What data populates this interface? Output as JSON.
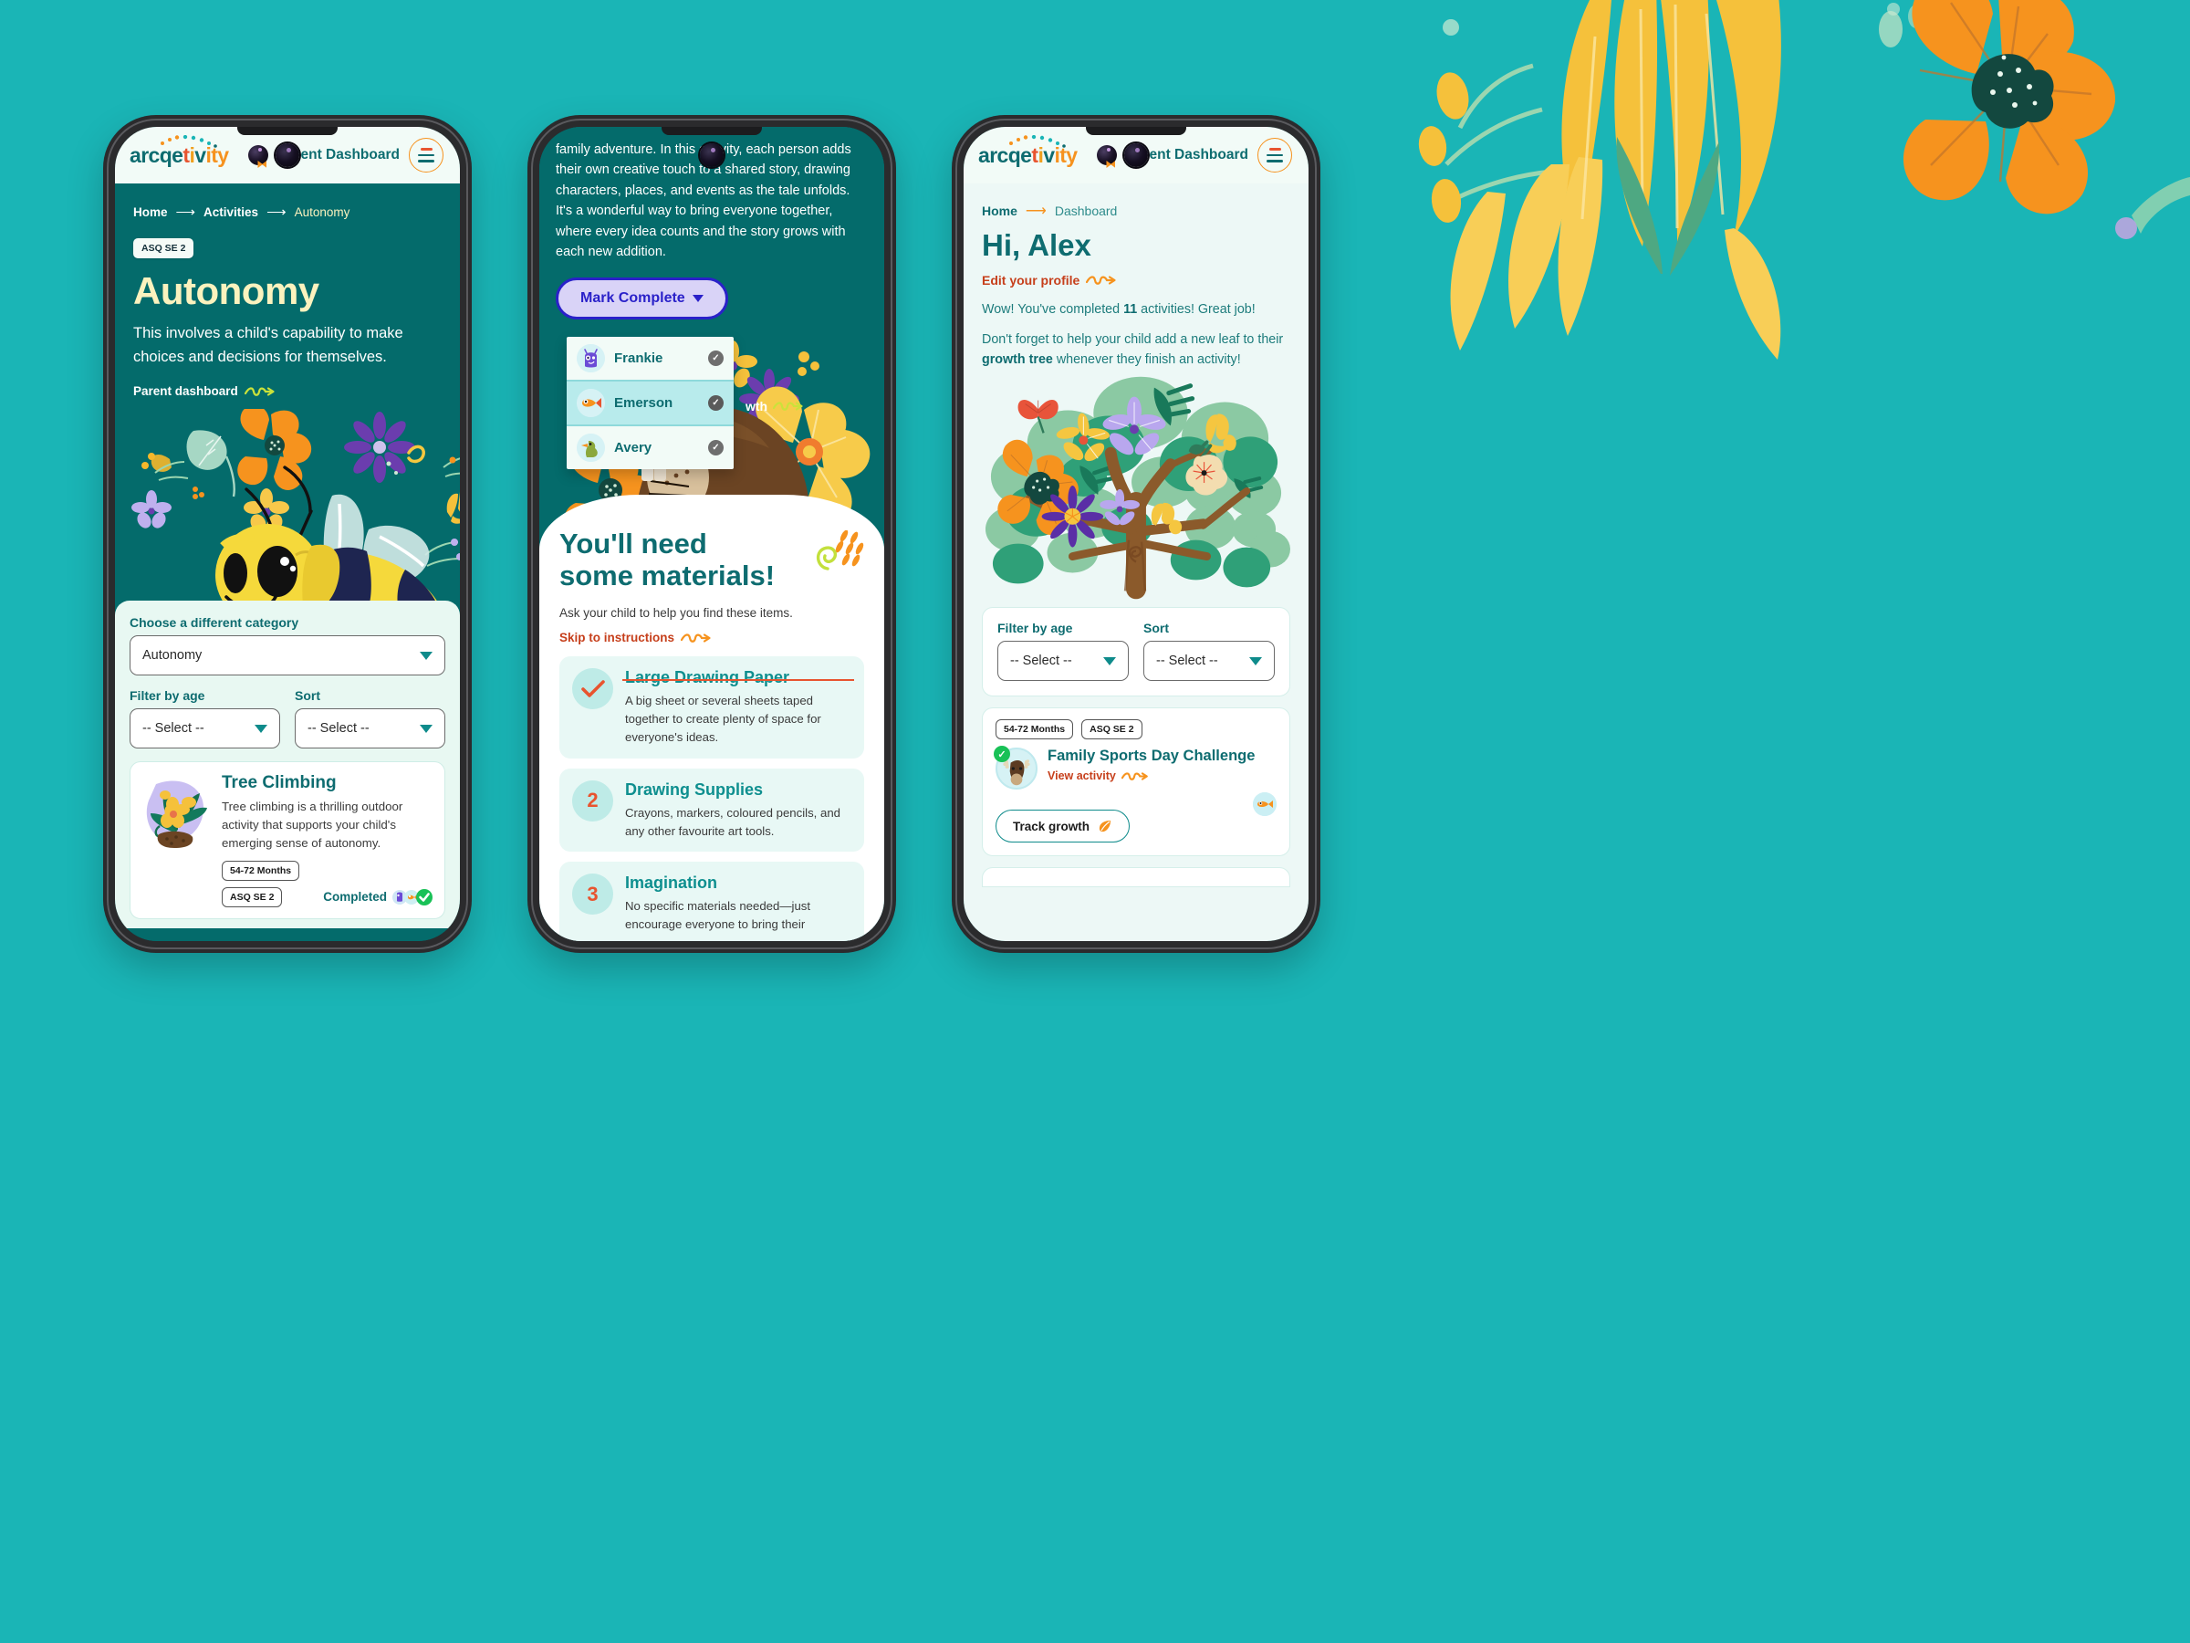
{
  "brand": {
    "logo_parts": [
      "arcqe",
      "t",
      "i",
      "v",
      "ity"
    ],
    "logo_full": "arcqetivity",
    "accent_teal": "#0E6C70",
    "accent_orange": "#F6921E",
    "accent_red": "#E8542F",
    "bg_teal": "#1AB5B6",
    "deep_teal": "#046B6B"
  },
  "header": {
    "dashboard_label": "Parent Dashboard",
    "avatar_name": "user-avatar",
    "menu_icon": "hamburger-menu-icon"
  },
  "phone1": {
    "breadcrumb": {
      "home": "Home",
      "activities": "Activities",
      "current": "Autonomy"
    },
    "badge": "ASQ SE 2",
    "title": "Autonomy",
    "description": "This involves a child's capability to make choices and decisions for themselves.",
    "parent_dashboard_link": "Parent dashboard",
    "hero_illustration": "bee-illustration",
    "panel": {
      "category_label": "Choose a different category",
      "category_value": "Autonomy",
      "age_label": "Filter by age",
      "age_value": "-- Select --",
      "sort_label": "Sort",
      "sort_value": "-- Select --"
    },
    "activity": {
      "thumb": "plant-illustration",
      "title": "Tree Climbing",
      "description": "Tree climbing is a thrilling outdoor activity that supports your child's emerging sense of autonomy.",
      "age_tag": "54-72 Months",
      "framework_tag": "ASQ SE 2",
      "status": "Completed"
    }
  },
  "phone2": {
    "paragraph": "family adventure. In this activity, each person adds their own creative touch to a shared story, drawing characters, places, and events as the tale unfolds. It's a wonderful way to bring everyone together, where every idea counts and the story grows with each new addition.",
    "mark_complete_button": "Mark Complete",
    "kids": [
      {
        "name": "Frankie",
        "avatar": "purple-monster-avatar",
        "selected": false
      },
      {
        "name": "Emerson",
        "avatar": "orange-fish-avatar",
        "selected": true
      },
      {
        "name": "Avery",
        "avatar": "green-duck-avatar",
        "selected": false
      }
    ],
    "partial_link": "wth",
    "hero_illustration": "beaver-illustration",
    "materials": {
      "heading": "You'll need some materials!",
      "subtitle": "Ask your child to help you find these items.",
      "skip_link": "Skip to instructions",
      "items": [
        {
          "marker": "check",
          "title": "Large Drawing Paper",
          "struck": true,
          "description": "A big sheet or several sheets taped together to create plenty of space for everyone's ideas."
        },
        {
          "marker": "2",
          "title": "Drawing Supplies",
          "struck": false,
          "description": "Crayons, markers, coloured pencils, and any other favourite art tools."
        },
        {
          "marker": "3",
          "title": "Imagination",
          "struck": false,
          "description": "No specific materials needed—just encourage everyone to bring their"
        }
      ]
    }
  },
  "phone3": {
    "breadcrumb": {
      "home": "Home",
      "current": "Dashboard"
    },
    "greeting": "Hi, Alex",
    "edit_profile_link": "Edit your profile",
    "completed_line_pre": "Wow! You've completed ",
    "completed_count": "11",
    "completed_line_post": " activities! Great job!",
    "reminder_pre": "Don't forget to help your child add a new leaf to their ",
    "reminder_bold": "growth tree",
    "reminder_post": " whenever they finish an activity!",
    "tree_illustration": "growth-tree-illustration",
    "filters": {
      "age_label": "Filter by age",
      "age_value": "-- Select --",
      "sort_label": "Sort",
      "sort_value": "-- Select --"
    },
    "activity": {
      "age_tag": "54-72 Months",
      "framework_tag": "ASQ SE 2",
      "title": "Family Sports Day Challenge",
      "view_link": "View activity",
      "avatar": "moose-avatar",
      "completed_badge": "completed-check",
      "floating_avatar": "orange-fish-avatar",
      "track_button": "Track growth"
    }
  }
}
